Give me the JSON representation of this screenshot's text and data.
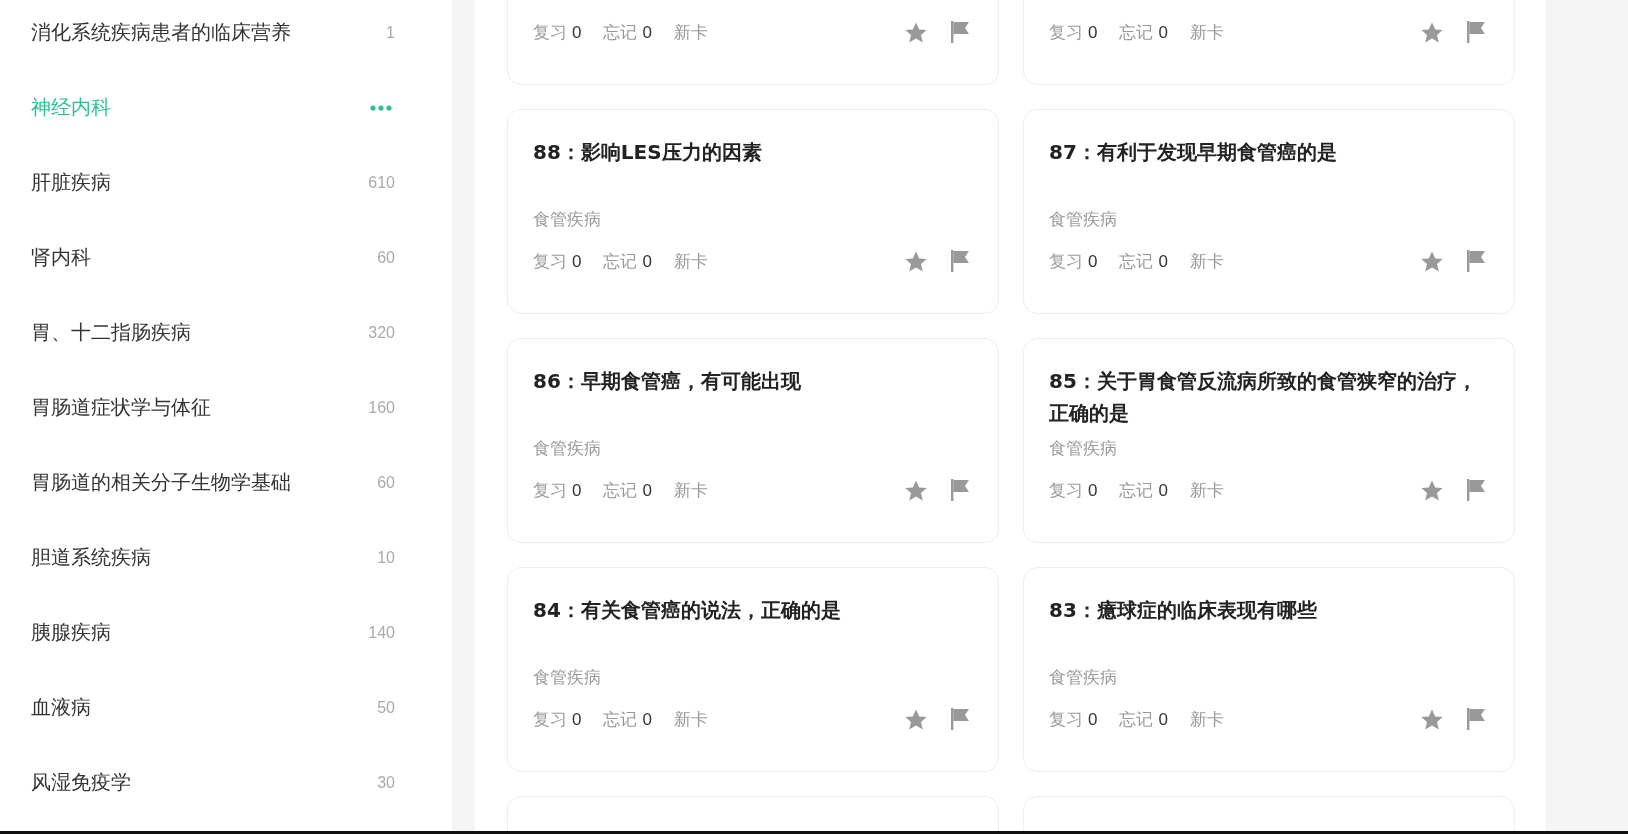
{
  "sidebar": {
    "items": [
      {
        "name": "消化系统疾病患者的临床营养",
        "count": "1",
        "selected": false
      },
      {
        "name": "神经内科",
        "selected": true
      },
      {
        "name": "肝脏疾病",
        "count": "610",
        "selected": false
      },
      {
        "name": "肾内科",
        "count": "60",
        "selected": false
      },
      {
        "name": "胃、十二指肠疾病",
        "count": "320",
        "selected": false
      },
      {
        "name": "胃肠道症状学与体征",
        "count": "160",
        "selected": false
      },
      {
        "name": "胃肠道的相关分子生物学基础",
        "count": "60",
        "selected": false
      },
      {
        "name": "胆道系统疾病",
        "count": "10",
        "selected": false
      },
      {
        "name": "胰腺疾病",
        "count": "140",
        "selected": false
      },
      {
        "name": "血液病",
        "count": "50",
        "selected": false
      },
      {
        "name": "风湿免疫学",
        "count": "30",
        "selected": false
      }
    ]
  },
  "cards": [
    {
      "stats": [
        {
          "label": "复习",
          "count": "0"
        },
        {
          "label": "忘记",
          "count": "0"
        },
        {
          "label": "新卡"
        }
      ]
    },
    {
      "stats": [
        {
          "label": "复习",
          "count": "0"
        },
        {
          "label": "忘记",
          "count": "0"
        },
        {
          "label": "新卡"
        }
      ]
    },
    {
      "title": "88：影响LES压力的因素",
      "category": "食管疾病",
      "stats": [
        {
          "label": "复习",
          "count": "0"
        },
        {
          "label": "忘记",
          "count": "0"
        },
        {
          "label": "新卡"
        }
      ]
    },
    {
      "title": "87：有利于发现早期食管癌的是",
      "category": "食管疾病",
      "stats": [
        {
          "label": "复习",
          "count": "0"
        },
        {
          "label": "忘记",
          "count": "0"
        },
        {
          "label": "新卡"
        }
      ]
    },
    {
      "title": "86：早期食管癌，有可能出现",
      "category": "食管疾病",
      "stats": [
        {
          "label": "复习",
          "count": "0"
        },
        {
          "label": "忘记",
          "count": "0"
        },
        {
          "label": "新卡"
        }
      ]
    },
    {
      "title": "85：关于胃食管反流病所致的食管狭窄的治疗，正确的是",
      "category": "食管疾病",
      "stats": [
        {
          "label": "复习",
          "count": "0"
        },
        {
          "label": "忘记",
          "count": "0"
        },
        {
          "label": "新卡"
        }
      ]
    },
    {
      "title": "84：有关食管癌的说法，正确的是",
      "category": "食管疾病",
      "stats": [
        {
          "label": "复习",
          "count": "0"
        },
        {
          "label": "忘记",
          "count": "0"
        },
        {
          "label": "新卡"
        }
      ]
    },
    {
      "title": "83：癔球症的临床表现有哪些",
      "category": "食管疾病",
      "stats": [
        {
          "label": "复习",
          "count": "0"
        },
        {
          "label": "忘记",
          "count": "0"
        },
        {
          "label": "新卡"
        }
      ]
    }
  ]
}
